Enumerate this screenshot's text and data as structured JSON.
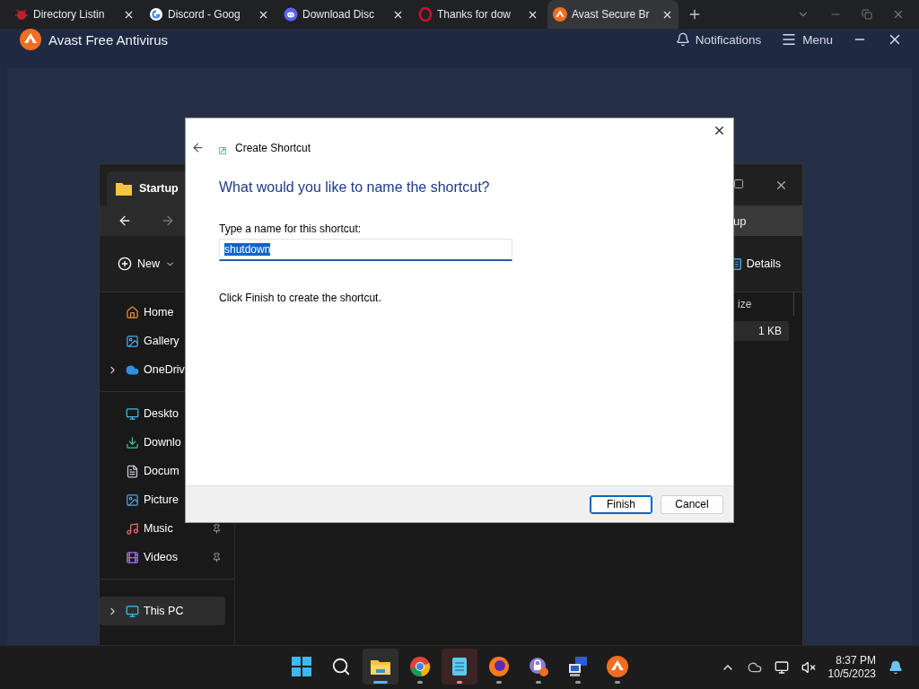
{
  "browser": {
    "tabs": [
      {
        "title": "Directory Listin",
        "kind": "bug",
        "selected": false
      },
      {
        "title": "Discord - Goog",
        "kind": "google",
        "selected": false
      },
      {
        "title": "Download Disc",
        "kind": "discord",
        "selected": false
      },
      {
        "title": "Thanks for dow",
        "kind": "opera",
        "selected": false
      },
      {
        "title": "Avast Secure Br",
        "kind": "avast",
        "selected": true
      }
    ]
  },
  "app": {
    "title": "Avast Free Antivirus",
    "notifications": "Notifications",
    "menu": "Menu"
  },
  "explorer": {
    "tab": "Startup",
    "search_text": "up",
    "new_button": "New",
    "view_button": "Details",
    "column_header": "ize",
    "file_size": "1 KB",
    "sidebar": [
      {
        "items": [
          {
            "label": "Home",
            "kind": "home",
            "expandable": false,
            "selected": false
          },
          {
            "label": "Gallery",
            "kind": "gallery",
            "expandable": false,
            "selected": false
          },
          {
            "label": "OneDriv",
            "kind": "cloud",
            "expandable": true,
            "selected": false
          }
        ]
      },
      {
        "items": [
          {
            "label": "Deskto",
            "kind": "desktop",
            "expandable": false,
            "selected": false
          },
          {
            "label": "Downlo",
            "kind": "download",
            "expandable": false,
            "selected": false
          },
          {
            "label": "Docum",
            "kind": "document",
            "expandable": false,
            "selected": false
          },
          {
            "label": "Picture",
            "kind": "gallery",
            "expandable": false,
            "selected": false
          },
          {
            "label": "Music",
            "kind": "music",
            "expandable": false,
            "pinned": true,
            "selected": false
          },
          {
            "label": "Videos",
            "kind": "video",
            "expandable": false,
            "pinned": true,
            "selected": false
          }
        ]
      },
      {
        "items": [
          {
            "label": "This PC",
            "kind": "pc",
            "expandable": true,
            "pinned": false,
            "selected": true
          }
        ]
      }
    ]
  },
  "dialog": {
    "title": "Create Shortcut",
    "heading": "What would you like to name the shortcut?",
    "field_label": "Type a name for this shortcut:",
    "field_value": "shutdown",
    "value_selected": true,
    "hint": "Click Finish to create the shortcut.",
    "buttons": [
      {
        "label": "Finish",
        "default": true
      },
      {
        "label": "Cancel",
        "default": false
      }
    ]
  },
  "taskbar": {
    "apps": [
      {
        "kind": "start",
        "running": false,
        "active": false,
        "attention": false
      },
      {
        "kind": "search",
        "running": false,
        "active": false,
        "attention": false
      },
      {
        "kind": "explorer",
        "running": true,
        "active": true,
        "attention": false
      },
      {
        "kind": "chrome",
        "running": true,
        "active": false,
        "attention": false
      },
      {
        "kind": "notepad",
        "running": true,
        "active": false,
        "attention": true
      },
      {
        "kind": "firefox",
        "running": true,
        "active": false,
        "attention": false
      },
      {
        "kind": "vpn",
        "running": true,
        "active": false,
        "attention": false
      },
      {
        "kind": "network",
        "running": true,
        "active": false,
        "attention": false
      },
      {
        "kind": "avast",
        "running": true,
        "active": false,
        "attention": false
      }
    ],
    "time": "8:37 PM",
    "date": "10/5/2023"
  }
}
